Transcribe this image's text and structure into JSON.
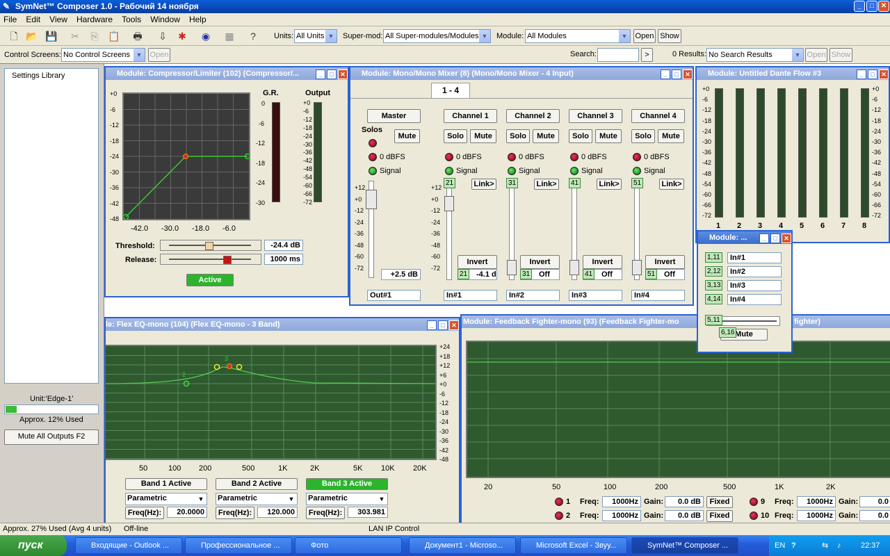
{
  "app": {
    "title": "SymNet™ Composer 1.0 - Рабочий 14 ноября"
  },
  "menu": [
    "File",
    "Edit",
    "View",
    "Hardware",
    "Tools",
    "Window",
    "Help"
  ],
  "toolbar": {
    "units_label": "Units:",
    "units_value": "All Units",
    "supermod_label": "Super-mod:",
    "supermod_value": "All Super-modules/Modules",
    "module_label": "Module:",
    "module_value": "All Modules",
    "open": "Open",
    "show": "Show"
  },
  "toolbar2": {
    "cs_label": "Control Screens:",
    "cs_value": "No Control Screens",
    "cs_open": "Open",
    "search_label": "Search:",
    "search_go": ">",
    "results_label": "0 Results:",
    "results_value": "No Search Results",
    "results_open": "Open",
    "results_show": "Show"
  },
  "left": {
    "tree_item": "Settings Library",
    "unit": "Unit:'Edge-1'",
    "usage": "Approx. 12% Used",
    "mute_all": "Mute All Outputs  F2"
  },
  "comp": {
    "title": "Module: Compressor/Limiter (102) (Compressor/...",
    "gr_label": "G.R.",
    "out_label": "Output",
    "yticks": [
      "+0",
      "-6",
      "-12",
      "-18",
      "-24",
      "-30",
      "-36",
      "-42",
      "-48"
    ],
    "xticks": [
      "-42.0",
      "-30.0",
      "-18.0",
      "-6.0"
    ],
    "gr_ticks": [
      "0",
      "-6",
      "-12",
      "-18",
      "-24",
      "-30"
    ],
    "out_ticks": [
      "+0",
      "-6",
      "-12",
      "-18",
      "-24",
      "-30",
      "-36",
      "-42",
      "-48",
      "-54",
      "-60",
      "-66",
      "-72"
    ],
    "threshold_label": "Threshold:",
    "threshold_value": "-24.4 dB",
    "release_label": "Release:",
    "release_value": "1000 ms",
    "active": "Active"
  },
  "mixer": {
    "title": "Module: Mono/Mono Mixer (8) (Mono/Mono Mixer - 4 Input)",
    "tab": "1 - 4",
    "master": "Master",
    "solos": "Solos",
    "mute": "Mute",
    "solo": "Solo",
    "dbfs": "0 dBFS",
    "signal": "Signal",
    "link": "Link>",
    "invert": "Invert",
    "master_gain": "+2.5 dB",
    "master_out": "Out#1",
    "fader_ticks": [
      "+12",
      "+0",
      "-12",
      "-24",
      "-36",
      "-48",
      "-60",
      "-72"
    ],
    "channels": [
      {
        "name": "Channel 1",
        "id": "21",
        "val": "-4.1 dB",
        "in": "In#1"
      },
      {
        "name": "Channel 2",
        "id": "31",
        "val": "Off",
        "in": "In#2"
      },
      {
        "name": "Channel 3",
        "id": "41",
        "val": "Off",
        "in": "In#3"
      },
      {
        "name": "Channel 4",
        "id": "51",
        "val": "Off",
        "in": "In#4"
      }
    ]
  },
  "dante": {
    "title": "Module: Untitled Dante Flow #3",
    "ticks": [
      "+0",
      "-6",
      "-12",
      "-18",
      "-24",
      "-30",
      "-36",
      "-42",
      "-48",
      "-54",
      "-60",
      "-66",
      "-72"
    ],
    "channels": [
      "1",
      "2",
      "3",
      "4",
      "5",
      "6",
      "7",
      "8"
    ]
  },
  "small": {
    "title": "Module: ...",
    "rows": [
      {
        "id": "1,11",
        "name": "In#1"
      },
      {
        "id": "2,12",
        "name": "In#2"
      },
      {
        "id": "3,13",
        "name": "In#3"
      },
      {
        "id": "4,14",
        "name": "In#4"
      }
    ],
    "slider_id": "5,11",
    "mute_id": "6,16",
    "mute": "Mute"
  },
  "eq": {
    "title": "le: Flex EQ-mono (104) (Flex EQ-mono - 3 Band)",
    "yticks": [
      "+24",
      "+18",
      "+12",
      "+6",
      "+0",
      "-6",
      "-12",
      "-18",
      "-24",
      "-30",
      "-36",
      "-42",
      "-48"
    ],
    "xticks": [
      "50",
      "100",
      "200",
      "500",
      "1K",
      "2K",
      "5K",
      "10K",
      "20K"
    ],
    "bands": [
      {
        "label": "Band 1 Active",
        "type": "Parametric",
        "freq": "20.0000"
      },
      {
        "label": "Band 2 Active",
        "type": "Parametric",
        "freq": "120.000"
      },
      {
        "label": "Band 3 Active",
        "type": "Parametric",
        "freq": "303.981"
      }
    ],
    "freq_label": "Freq(Hz):",
    "point2": "2",
    "point3": "3"
  },
  "ff": {
    "title": "Module: Feedback Fighter-mono (93) (Feedback Fighter-mo",
    "title_tail": "fighter)",
    "xticks": [
      "20",
      "50",
      "100",
      "200",
      "500",
      "1K",
      "2K"
    ],
    "rows": [
      {
        "n": "1",
        "freq": "1000Hz",
        "gain": "0.0 dB",
        "mode": "Fixed",
        "n2": "9",
        "freq2": "1000Hz",
        "gain2": "0.0"
      },
      {
        "n": "2",
        "freq": "1000Hz",
        "gain": "0.0 dB",
        "mode": "Fixed",
        "n2": "10",
        "freq2": "1000Hz",
        "gain2": "0.0"
      }
    ],
    "freq_label": "Freq:",
    "gain_label": "Gain:"
  },
  "status": {
    "usage": "Approx. 27% Used (Avg 4 units)",
    "mode": "Off-line",
    "net": "LAN IP Control"
  },
  "taskbar": {
    "start": "пуск",
    "tasks": [
      "Входящие - Outlook ...",
      "Профессиональное ...",
      "Фото",
      "Документ1 - Microso...",
      "Microsoft Excel - Звуу...",
      "SymNet™ Composer ..."
    ],
    "lang": "EN",
    "time": "22:37"
  }
}
